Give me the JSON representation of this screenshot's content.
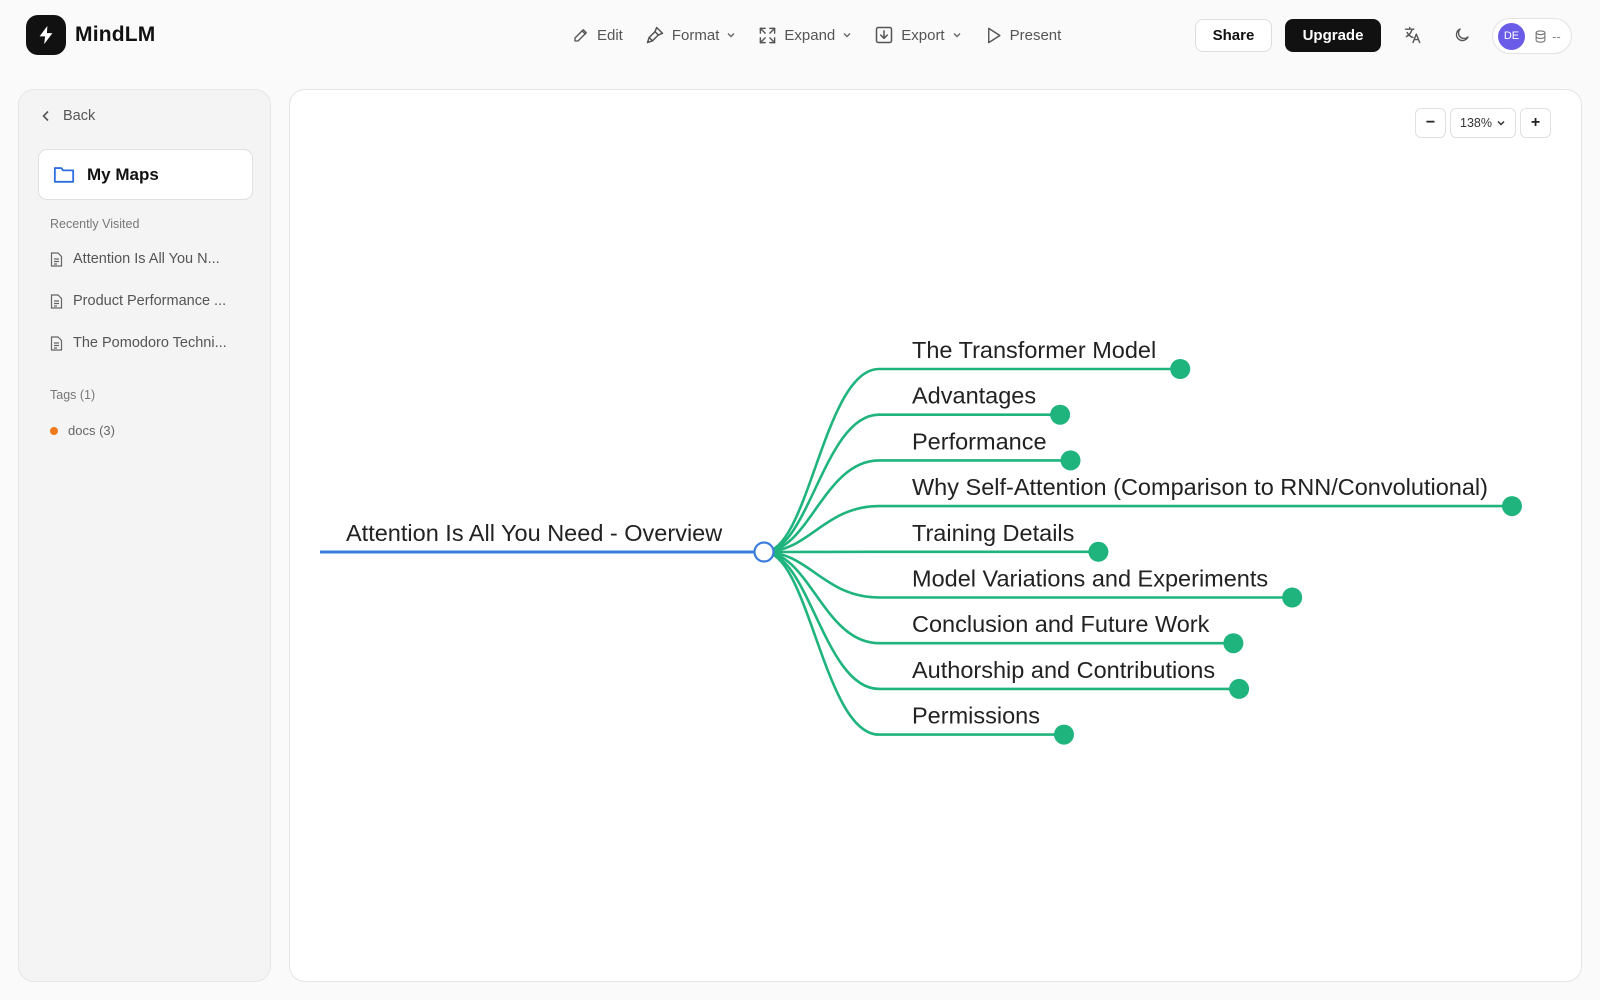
{
  "app": {
    "name": "MindLM"
  },
  "toolbar": {
    "edit": "Edit",
    "format": "Format",
    "expand": "Expand",
    "export": "Export",
    "present": "Present"
  },
  "header": {
    "share": "Share",
    "upgrade": "Upgrade",
    "avatar_initials": "DE",
    "credits": "--"
  },
  "sidebar": {
    "back": "Back",
    "my_maps": "My Maps",
    "recent_label": "Recently Visited",
    "recent": [
      "Attention Is All You N...",
      "Product Performance ...",
      "The Pomodoro Techni..."
    ],
    "tags_label": "Tags (1)",
    "tags": [
      {
        "label": "docs (3)",
        "color": "#f07a1a"
      }
    ]
  },
  "zoom": {
    "level": "138%",
    "minus": "−",
    "plus": "+"
  },
  "mindmap": {
    "root": "Attention Is All You Need - Overview",
    "root_color": "#3b7ddd",
    "branch_color": "#1fb47e",
    "children": [
      "The Transformer Model",
      "Advantages",
      "Performance",
      "Why Self-Attention (Comparison to RNN/Convolutional)",
      "Training Details",
      "Model Variations and Experiments",
      "Conclusion and Future Work",
      "Authorship and Contributions",
      "Permissions"
    ]
  }
}
